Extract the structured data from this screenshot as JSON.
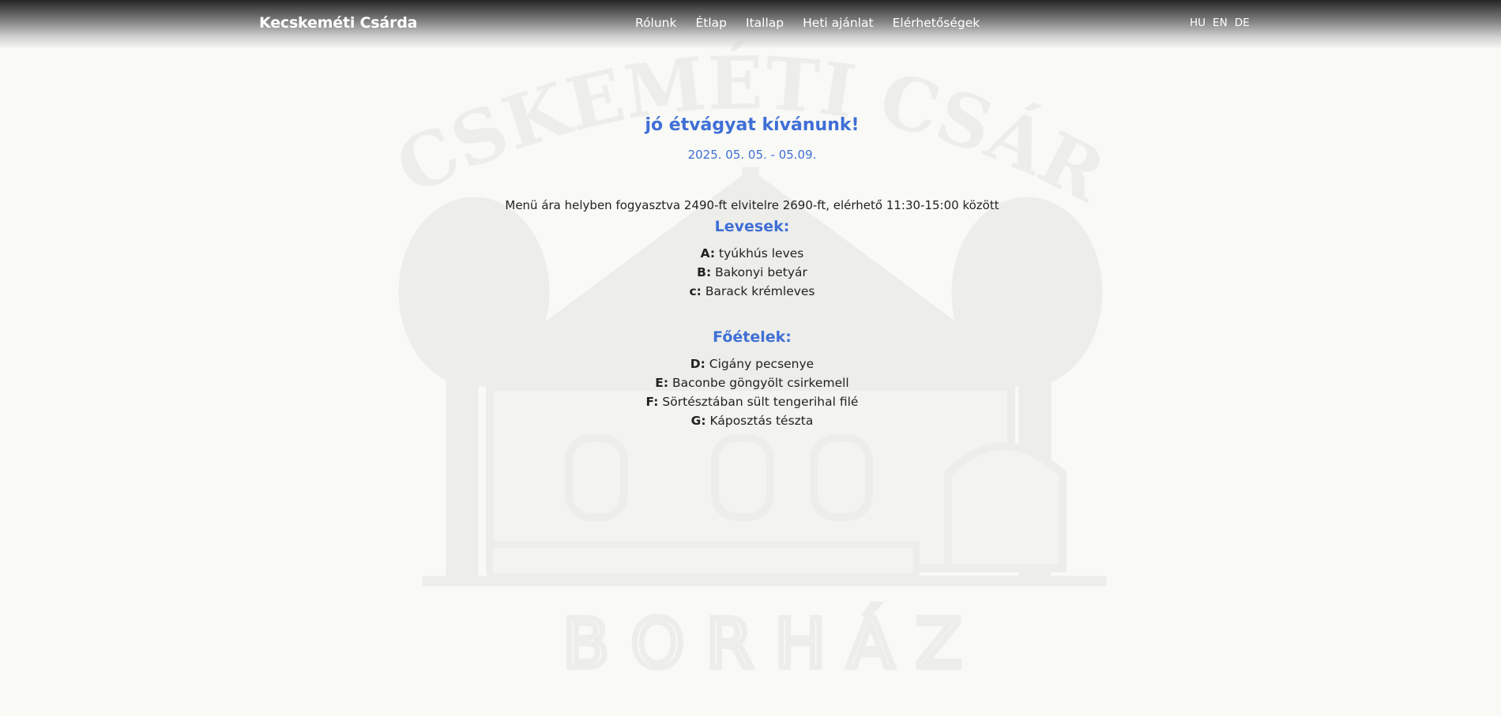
{
  "header": {
    "brand": "Kecskeméti Csárda",
    "nav": [
      "Rólunk",
      "Étlap",
      "Itallap",
      "Heti ajánlat",
      "Elérhetőségek"
    ],
    "languages": [
      "HU",
      "EN",
      "DE"
    ]
  },
  "watermark": {
    "arc_text": "KECSKEMÉTI CSÁRDA",
    "bottom_text": "B O R H Á Z"
  },
  "main": {
    "greeting": "jó étvágyat kívánunk!",
    "date_range": "2025. 05. 05. - 05.09.",
    "price_info": "Menü ára helyben fogyasztva 2490-ft elvitelre 2690-ft, elérhető 11:30-15:00 között",
    "soups": {
      "title": "Levesek:",
      "items": [
        {
          "code": "A:",
          "name": "tyúkhús leves"
        },
        {
          "code": "B:",
          "name": "Bakonyi betyár"
        },
        {
          "code": "c:",
          "name": "Barack krémleves"
        }
      ]
    },
    "mains": {
      "title": "Főételek:",
      "items": [
        {
          "code": "D:",
          "name": "Cigány pecsenye"
        },
        {
          "code": "E:",
          "name": "Baconbe göngyölt csirkemell"
        },
        {
          "code": "F:",
          "name": "Sörtésztában sült tengerihal filé"
        },
        {
          "code": "G:",
          "name": "Káposztás tészta"
        }
      ]
    }
  },
  "colors": {
    "accent": "#3f6fd6",
    "background": "#f9f9f6",
    "watermark": "#ededea"
  }
}
